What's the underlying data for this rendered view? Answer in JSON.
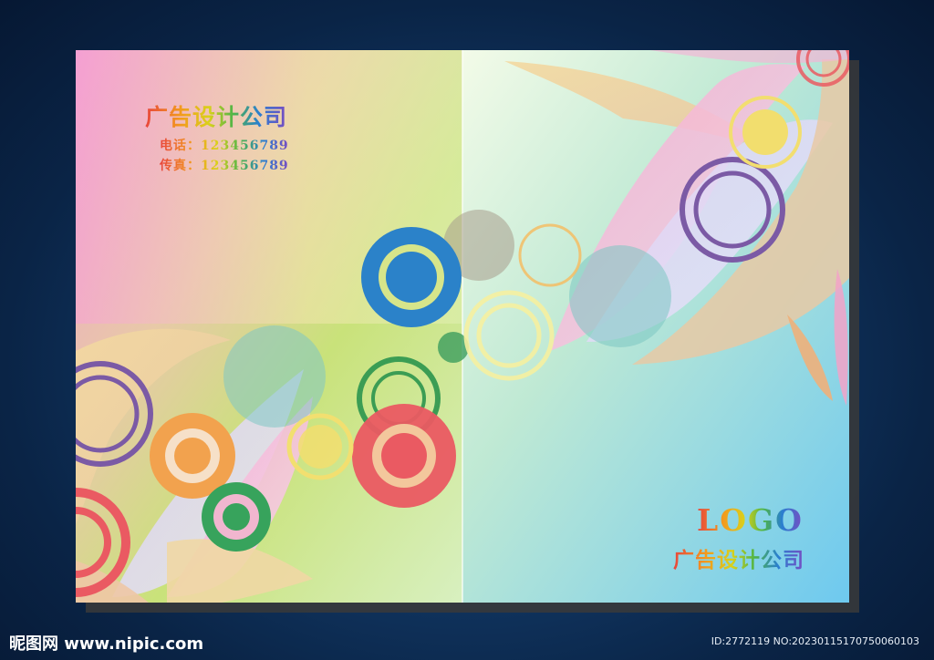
{
  "cover": {
    "company_name": "广告设计公司",
    "phone_line": "电话：123456789",
    "fax_line": "传真：123456789",
    "logo_text": "LOGO",
    "company_name_back": "广告设计公司"
  },
  "footer": {
    "site": "昵图网 www.nipic.com",
    "image_id": "ID:2772119 NO:20230115170750060103"
  }
}
